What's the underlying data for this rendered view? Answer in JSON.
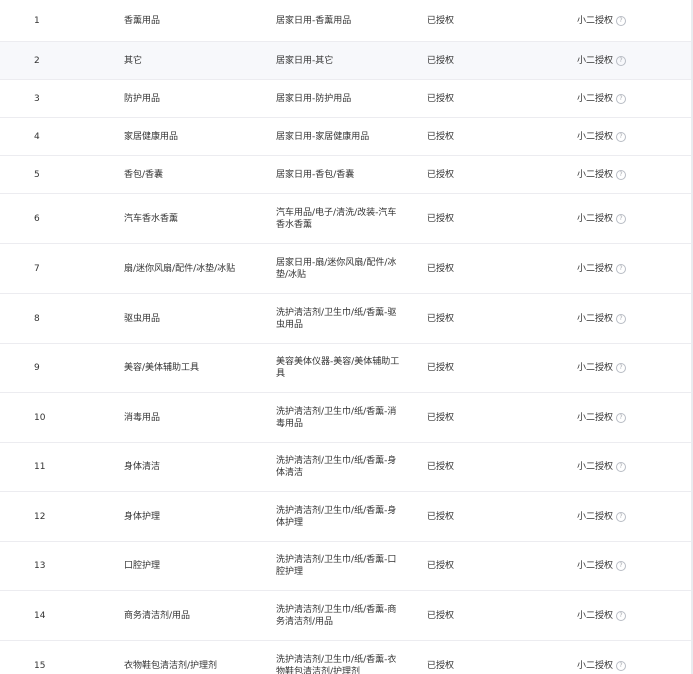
{
  "table": {
    "rows": [
      {
        "idx": "1",
        "name": "香薰用品",
        "path": "居家日用-香薰用品",
        "auth": "已授权",
        "type": "小二授权"
      },
      {
        "idx": "2",
        "name": "其它",
        "path": "居家日用-其它",
        "auth": "已授权",
        "type": "小二授权"
      },
      {
        "idx": "3",
        "name": "防护用品",
        "path": "居家日用-防护用品",
        "auth": "已授权",
        "type": "小二授权"
      },
      {
        "idx": "4",
        "name": "家居健康用品",
        "path": "居家日用-家居健康用品",
        "auth": "已授权",
        "type": "小二授权"
      },
      {
        "idx": "5",
        "name": "香包/香囊",
        "path": "居家日用-香包/香囊",
        "auth": "已授权",
        "type": "小二授权"
      },
      {
        "idx": "6",
        "name": "汽车香水香薰",
        "path": "汽车用品/电子/清洗/改装-汽车香水香薰",
        "auth": "已授权",
        "type": "小二授权"
      },
      {
        "idx": "7",
        "name": "扇/迷你风扇/配件/冰垫/冰贴",
        "path": "居家日用-扇/迷你风扇/配件/冰垫/冰贴",
        "auth": "已授权",
        "type": "小二授权"
      },
      {
        "idx": "8",
        "name": "驱虫用品",
        "path": "洗护清洁剂/卫生巾/纸/香薰-驱虫用品",
        "auth": "已授权",
        "type": "小二授权"
      },
      {
        "idx": "9",
        "name": "美容/美体辅助工具",
        "path": "美容美体仪器-美容/美体辅助工具",
        "auth": "已授权",
        "type": "小二授权"
      },
      {
        "idx": "10",
        "name": "消毒用品",
        "path": "洗护清洁剂/卫生巾/纸/香薰-消毒用品",
        "auth": "已授权",
        "type": "小二授权"
      },
      {
        "idx": "11",
        "name": "身体清洁",
        "path": "洗护清洁剂/卫生巾/纸/香薰-身体清洁",
        "auth": "已授权",
        "type": "小二授权"
      },
      {
        "idx": "12",
        "name": "身体护理",
        "path": "洗护清洁剂/卫生巾/纸/香薰-身体护理",
        "auth": "已授权",
        "type": "小二授权"
      },
      {
        "idx": "13",
        "name": "口腔护理",
        "path": "洗护清洁剂/卫生巾/纸/香薰-口腔护理",
        "auth": "已授权",
        "type": "小二授权"
      },
      {
        "idx": "14",
        "name": "商务清洁剂/用品",
        "path": "洗护清洁剂/卫生巾/纸/香薰-商务清洁剂/用品",
        "auth": "已授权",
        "type": "小二授权"
      },
      {
        "idx": "15",
        "name": "衣物鞋包清洁剂/护理剂",
        "path": "洗护清洁剂/卫生巾/纸/香薰-衣物鞋包清洁剂/护理剂",
        "auth": "已授权",
        "type": "小二授权"
      }
    ],
    "help_icon": "question-circle-icon"
  }
}
